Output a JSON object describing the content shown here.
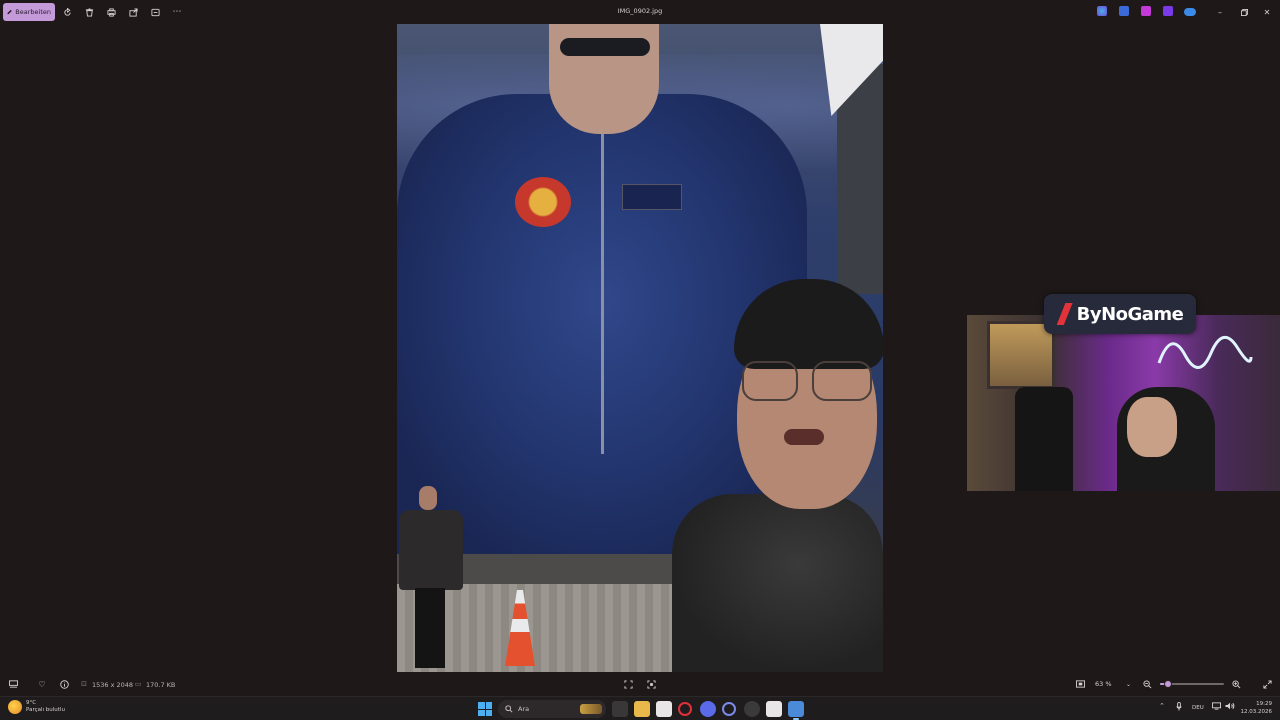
{
  "toolbar": {
    "edit_label": "Bearbeiten",
    "title": "IMG_0902.jpg"
  },
  "status": {
    "dimensions": "1536 x 2048",
    "filesize": "170.7 KB",
    "zoom": "63 %",
    "zoom_fraction": 0.12
  },
  "overlay": {
    "logo_text": "ByNoGame"
  },
  "taskbar": {
    "weather_temp": "9°C",
    "weather_desc": "Parçalı bulutlu",
    "search_placeholder": "Ara",
    "language": "DEU",
    "time": "19:29",
    "date": "12.03.2026"
  },
  "colors": {
    "accent": "#c59ad8",
    "background": "#1e1918"
  }
}
